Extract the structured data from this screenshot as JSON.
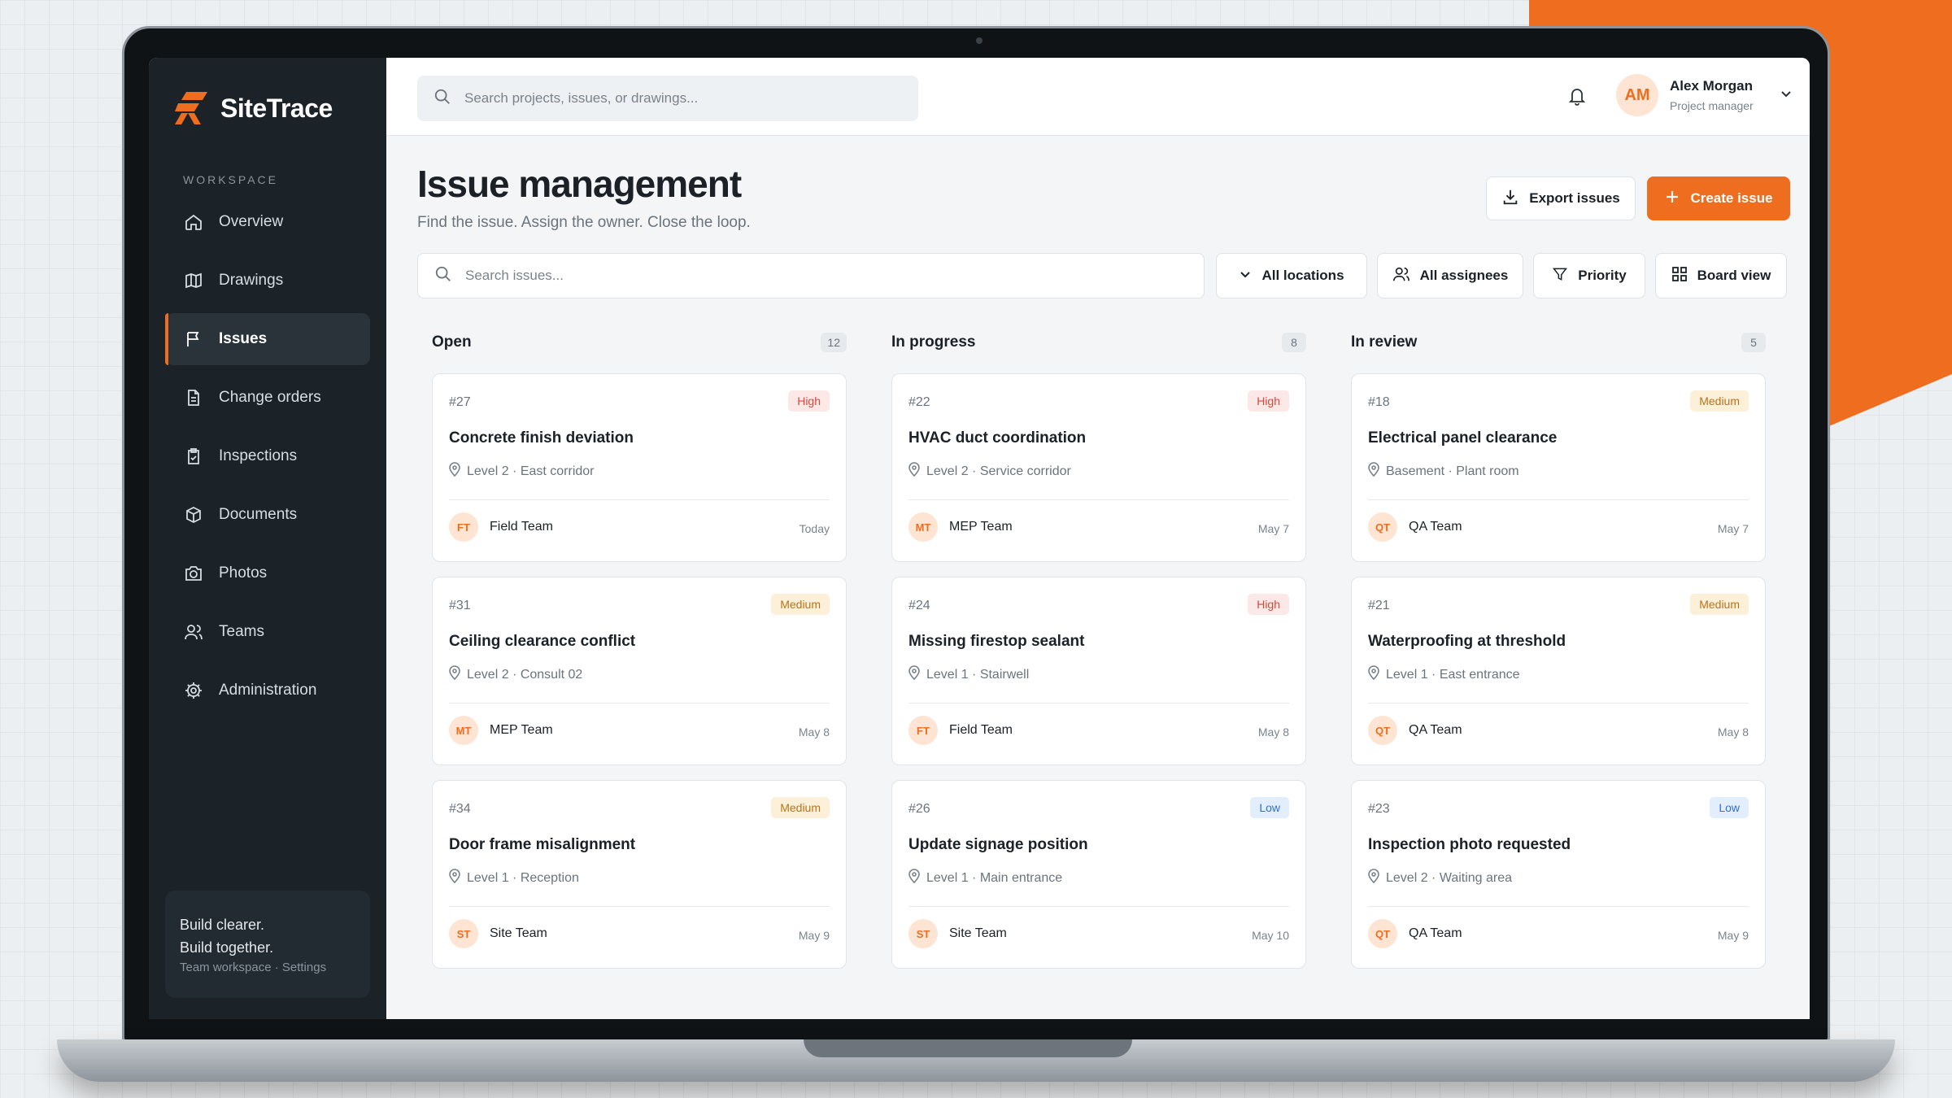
{
  "brand": {
    "name": "SiteTrace",
    "accent": "#ee6d1e",
    "sidebar_bg": "#1b2228"
  },
  "sidebar": {
    "section_label": "WORKSPACE",
    "items": [
      {
        "label": "Overview",
        "icon": "home-icon"
      },
      {
        "label": "Drawings",
        "icon": "map-icon"
      },
      {
        "label": "Issues",
        "icon": "flag-icon",
        "active": true
      },
      {
        "label": "Change orders",
        "icon": "document-icon"
      },
      {
        "label": "Inspections",
        "icon": "clipboard-check-icon"
      },
      {
        "label": "Documents",
        "icon": "box-icon"
      },
      {
        "label": "Photos",
        "icon": "camera-icon"
      },
      {
        "label": "Teams",
        "icon": "users-icon"
      },
      {
        "label": "Administration",
        "icon": "gear-icon"
      }
    ],
    "footer": {
      "line1": "Build clearer.",
      "line2": "Build together.",
      "line3": "Team workspace · Settings"
    }
  },
  "topbar": {
    "search_placeholder": "Search projects, issues, or drawings...",
    "user": {
      "initials": "AM",
      "name": "Alex Morgan",
      "role": "Project manager"
    }
  },
  "page": {
    "title": "Issue management",
    "subtitle": "Find the issue. Assign the owner. Close the loop.",
    "export_label": "Export issues",
    "create_label": "Create issue"
  },
  "filters": {
    "search_placeholder": "Search issues...",
    "locations": "All locations",
    "assignees": "All assignees",
    "priority": "Priority",
    "view": "Board view"
  },
  "columns": [
    {
      "title": "Open",
      "count": "12",
      "cards": [
        {
          "id": "#27",
          "priority": "High",
          "level": "high",
          "title": "Concrete finish deviation",
          "location": "Level 2 · East corridor",
          "team_initials": "FT",
          "team": "Field Team",
          "date": "Today"
        },
        {
          "id": "#31",
          "priority": "Medium",
          "level": "medium",
          "title": "Ceiling clearance conflict",
          "location": "Level 2 · Consult 02",
          "team_initials": "MT",
          "team": "MEP Team",
          "date": "May 8"
        },
        {
          "id": "#34",
          "priority": "Medium",
          "level": "medium",
          "title": "Door frame misalignment",
          "location": "Level 1 · Reception",
          "team_initials": "ST",
          "team": "Site Team",
          "date": "May 9"
        }
      ]
    },
    {
      "title": "In progress",
      "count": "8",
      "cards": [
        {
          "id": "#22",
          "priority": "High",
          "level": "high",
          "title": "HVAC duct coordination",
          "location": "Level 2 · Service corridor",
          "team_initials": "MT",
          "team": "MEP Team",
          "date": "May 7"
        },
        {
          "id": "#24",
          "priority": "High",
          "level": "high",
          "title": "Missing firestop sealant",
          "location": "Level 1 · Stairwell",
          "team_initials": "FT",
          "team": "Field Team",
          "date": "May 8"
        },
        {
          "id": "#26",
          "priority": "Low",
          "level": "low",
          "title": "Update signage position",
          "location": "Level 1 · Main entrance",
          "team_initials": "ST",
          "team": "Site Team",
          "date": "May 10"
        }
      ]
    },
    {
      "title": "In review",
      "count": "5",
      "cards": [
        {
          "id": "#18",
          "priority": "Medium",
          "level": "medium",
          "title": "Electrical panel clearance",
          "location": "Basement · Plant room",
          "team_initials": "QT",
          "team": "QA Team",
          "date": "May 7"
        },
        {
          "id": "#21",
          "priority": "Medium",
          "level": "medium",
          "title": "Waterproofing at threshold",
          "location": "Level 1 · East entrance",
          "team_initials": "QT",
          "team": "QA Team",
          "date": "May 8"
        },
        {
          "id": "#23",
          "priority": "Low",
          "level": "low",
          "title": "Inspection photo requested",
          "location": "Level 2 · Waiting area",
          "team_initials": "QT",
          "team": "QA Team",
          "date": "May 9"
        }
      ]
    }
  ]
}
